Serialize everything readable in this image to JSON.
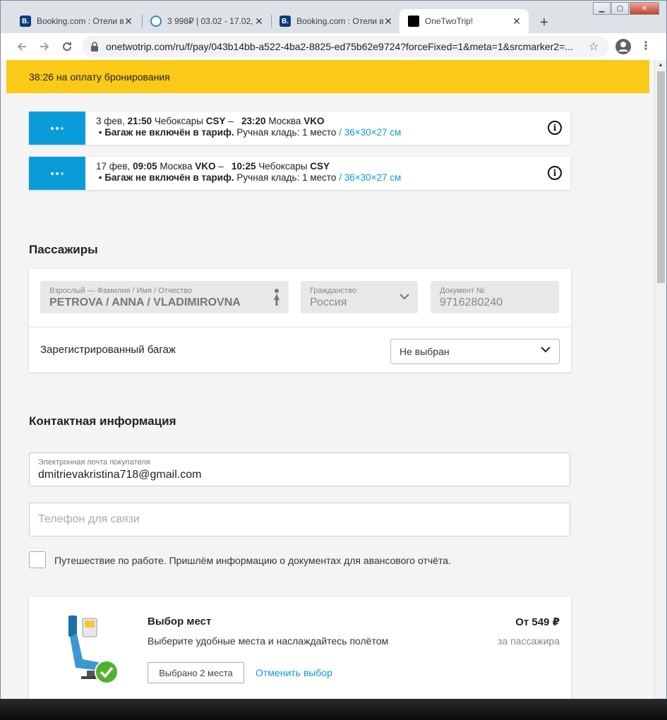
{
  "browser": {
    "tabs": [
      {
        "title": "Booking.com : Отели в",
        "favicon": "booking-b"
      },
      {
        "title": "3 998₽ | 03.02 - 17.02,",
        "favicon": "ozon-travel"
      },
      {
        "title": "Booking.com : Отели в",
        "favicon": "booking-b"
      },
      {
        "title": "OneTwoTrip!",
        "favicon": "briefcase"
      }
    ],
    "url": "onetwotrip.com/ru/f/pay/043b14bb-a522-4ba2-8825-ed75b62e9724?forceFixed=1&meta=1&srcmarker2=..."
  },
  "timer": {
    "text": "38:26 на оплату бронирования"
  },
  "flights": [
    {
      "date": "3 фев,",
      "dep_time": "21:50",
      "dep_city": "Чебоксары",
      "dep_code": "CSY",
      "arr_time": "23:20",
      "arr_city": "Москва",
      "arr_code": "VKO",
      "baggage_bold": "Багаж не включён в тариф.",
      "baggage_rest": "Ручная кладь: 1 место",
      "baggage_size": "36×30×27 см"
    },
    {
      "date": "17 фев,",
      "dep_time": "09:05",
      "dep_city": "Москва",
      "dep_code": "VKO",
      "arr_time": "10:25",
      "arr_city": "Чебоксары",
      "arr_code": "CSY",
      "baggage_bold": "Багаж не включён в тариф.",
      "baggage_rest": "Ручная кладь: 1 место",
      "baggage_size": "36×30×27 см"
    }
  ],
  "passengers": {
    "title": "Пассажиры",
    "name_label": "Взрослый — Фамилия / Имя / Отчество",
    "name_value": "PETROVA / ANNA / VLADIMIROVNA",
    "citizenship_label": "Гражданство",
    "citizenship_value": "Россия",
    "document_label": "Документ №",
    "document_value": "9716280240",
    "baggage_label": "Зарегистрированный багаж",
    "baggage_select": "Не выбран"
  },
  "contact": {
    "title": "Контактная информация",
    "email_label": "Электронная почта покупателя",
    "email_value": "dmitrievakristina718@gmail.com",
    "phone_placeholder": "Телефон для связи",
    "business_trip": "Путешествие по работе.  Пришлём информацию о документах для авансового отчёта."
  },
  "seats": {
    "title": "Выбор мест",
    "description": "Выберите удобные места и наслаждайтесь полётом",
    "price": "От 549 ₽",
    "per": "за пассажира",
    "selected_button": "Выбрано 2 места",
    "cancel_link": "Отменить выбор"
  },
  "colors": {
    "accent": "#0a9cd9",
    "timer_bg": "#fbc917",
    "success": "#52b030"
  }
}
